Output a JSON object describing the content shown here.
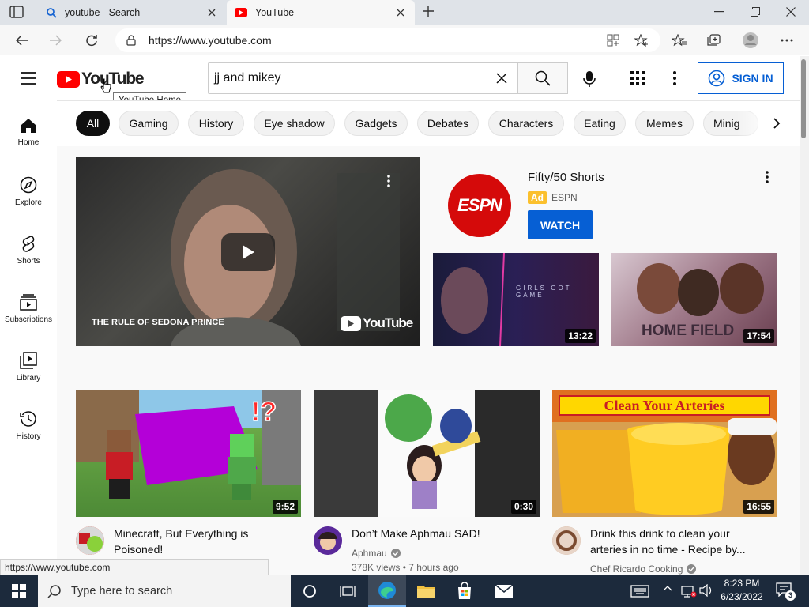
{
  "browser": {
    "tabs": [
      {
        "label": "youtube - Search",
        "icon": "search-icon"
      },
      {
        "label": "YouTube",
        "icon": "youtube-favicon"
      }
    ],
    "url": "https://www.youtube.com",
    "status_url": "https://www.youtube.com"
  },
  "header": {
    "logo_text": "YouTube",
    "tooltip": "YouTube Home",
    "search_value": "jj and mikey",
    "sign_in": "SIGN IN",
    "brand_color": "#ff0000",
    "link_color": "#065fd4"
  },
  "sidebar": {
    "items": [
      {
        "label": "Home",
        "icon": "home-icon"
      },
      {
        "label": "Explore",
        "icon": "compass-icon"
      },
      {
        "label": "Shorts",
        "icon": "shorts-icon"
      },
      {
        "label": "Subscriptions",
        "icon": "subscriptions-icon"
      },
      {
        "label": "Library",
        "icon": "library-icon"
      },
      {
        "label": "History",
        "icon": "history-icon"
      }
    ]
  },
  "chips": [
    "All",
    "Gaming",
    "History",
    "Eye shadow",
    "Gadgets",
    "Debates",
    "Characters",
    "Eating",
    "Memes",
    "Minig"
  ],
  "featured": {
    "banner_text": "THE RULE OF SEDONA PRINCE",
    "watermark": "YouTube",
    "ad_title": "Fifty/50 Shorts",
    "ad_badge": "Ad",
    "ad_channel": "ESPN",
    "ad_logo": "ESPN",
    "watch": "WATCH",
    "thumb1_text": "GIRLS GOT GAME",
    "thumb1_duration": "13:22",
    "thumb2_text": "HOME FIELD",
    "thumb2_duration": "17:54"
  },
  "videos": [
    {
      "title_line1": "Minecraft, But Everything is",
      "title_line2": "Poisoned!",
      "duration": "9:52",
      "channel": "",
      "meta": ""
    },
    {
      "title_line1": "Don’t Make Aphmau SAD!",
      "title_line2": "",
      "duration": "0:30",
      "channel": "Aphmau",
      "meta": "378K views • 7 hours ago"
    },
    {
      "title_line1": "Drink this drink to clean your",
      "title_line2": "arteries in no time - Recipe by...",
      "duration": "16:55",
      "channel": "Chef Ricardo Cooking",
      "meta": "",
      "thumb_banner": "Clean Your Arteries"
    }
  ],
  "taskbar": {
    "search_placeholder": "Type here to search",
    "time": "8:23 PM",
    "date": "6/23/2022",
    "notifications": "3"
  }
}
